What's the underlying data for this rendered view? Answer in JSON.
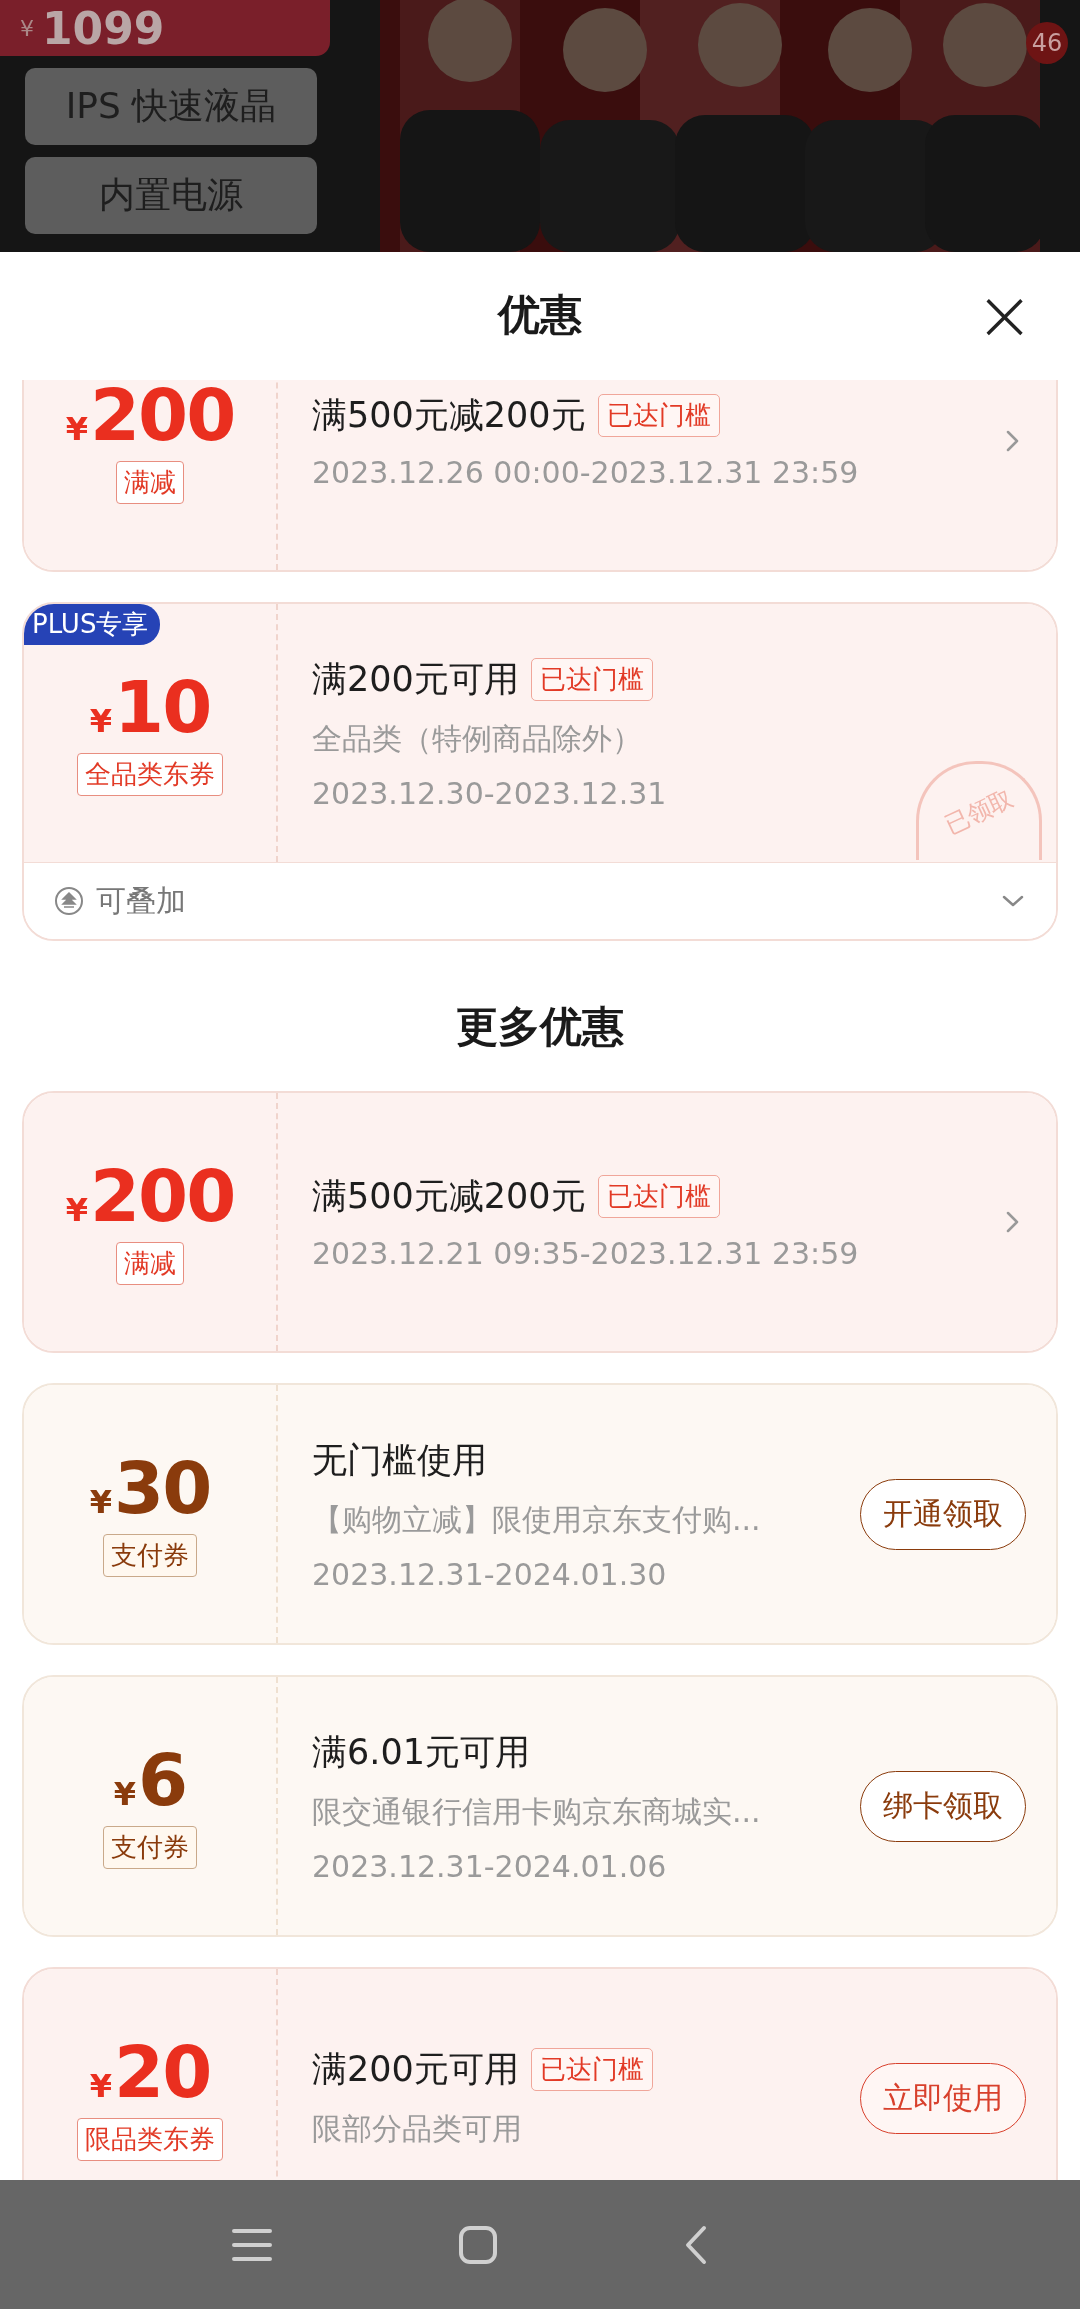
{
  "background_page": {
    "price": {
      "currency": "¥",
      "amount": "1099"
    },
    "feature_tags": [
      "IPS 快速液晶",
      "内置电源"
    ],
    "image_count": "46"
  },
  "sheet": {
    "title": "优惠",
    "close": "×"
  },
  "coupons": [
    {
      "kind": "red",
      "currency": "¥",
      "amount": "200",
      "tag": "满减",
      "title": "满500元减200元",
      "threshold_badge": "已达门槛",
      "lines": [
        "2023.12.26 00:00-2023.12.31 23:59"
      ],
      "action": {
        "kind": "chevron"
      }
    },
    {
      "kind": "red",
      "plus_badge": "PLUS专享",
      "currency": "¥",
      "amount": "10",
      "tag": "全品类东券",
      "title": "满200元可用",
      "threshold_badge": "已达门槛",
      "lines": [
        "全品类（特例商品除外）",
        "2023.12.30-2023.12.31"
      ],
      "stamp": "已领取",
      "footer": {
        "label": "可叠加",
        "expanded": false
      }
    }
  ],
  "more_section": {
    "title": "更多优惠"
  },
  "more_coupons": [
    {
      "kind": "red",
      "currency": "¥",
      "amount": "200",
      "tag": "满减",
      "title": "满500元减200元",
      "threshold_badge": "已达门槛",
      "lines": [
        "2023.12.21 09:35-2023.12.31 23:59"
      ],
      "action": {
        "kind": "chevron"
      }
    },
    {
      "kind": "brown",
      "currency": "¥",
      "amount": "30",
      "tag": "支付券",
      "title": "无门槛使用",
      "lines": [
        "【购物立减】限使用京东支付购...",
        "2023.12.31-2024.01.30"
      ],
      "action": {
        "kind": "button",
        "label": "开通领取"
      }
    },
    {
      "kind": "brown",
      "currency": "¥",
      "amount": "6",
      "tag": "支付券",
      "title": "满6.01元可用",
      "lines": [
        "限交通银行信用卡购京东商城实...",
        "2023.12.31-2024.01.06"
      ],
      "action": {
        "kind": "button",
        "label": "绑卡领取"
      }
    },
    {
      "kind": "red",
      "currency": "¥",
      "amount": "20",
      "tag": "限品类东券",
      "title": "满200元可用",
      "threshold_badge": "已达门槛",
      "lines": [
        "限部分品类可用"
      ],
      "action": {
        "kind": "button",
        "label": "立即使用"
      }
    }
  ]
}
